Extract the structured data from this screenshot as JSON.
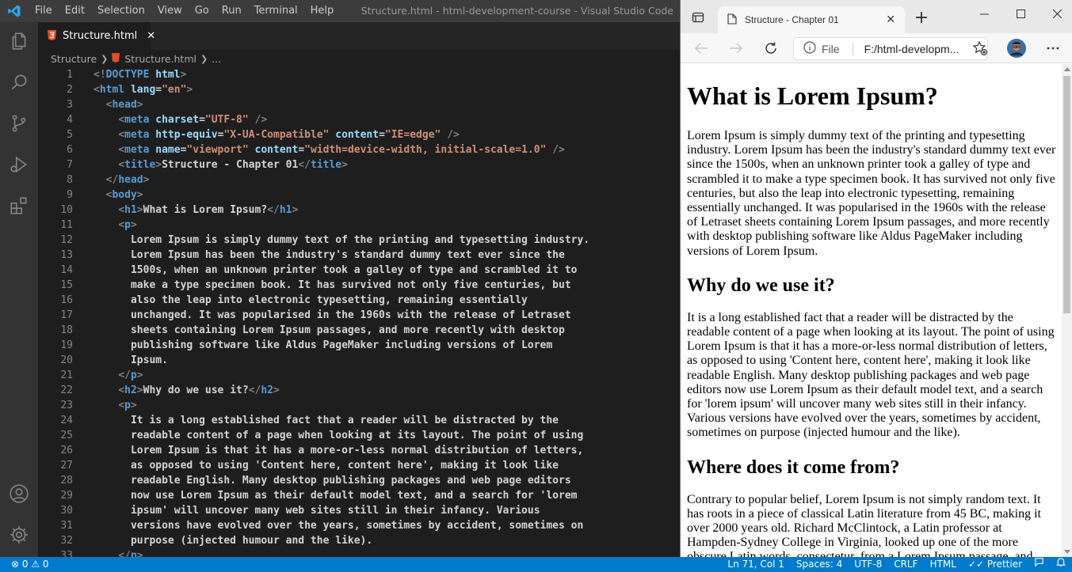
{
  "vscode": {
    "menu": [
      "File",
      "Edit",
      "Selection",
      "View",
      "Go",
      "Run",
      "Terminal",
      "Help"
    ],
    "window_title": "Structure.html - html-development-course - Visual Studio Code",
    "tab": {
      "label": "Structure.html",
      "close": "✕"
    },
    "breadcrumb": {
      "folder": "Structure",
      "file": "Structure.html",
      "more": "..."
    },
    "code_lines": [
      {
        "n": "1",
        "s": [
          [
            "p",
            "<!"
          ],
          [
            "tag",
            "DOCTYPE"
          ],
          [
            "text",
            " "
          ],
          [
            "attr",
            "html"
          ],
          [
            "p",
            ">"
          ]
        ]
      },
      {
        "n": "2",
        "s": [
          [
            "p",
            "<"
          ],
          [
            "tag",
            "html"
          ],
          [
            "text",
            " "
          ],
          [
            "attr",
            "lang"
          ],
          [
            "text",
            "="
          ],
          [
            "str",
            "\"en\""
          ],
          [
            "p",
            ">"
          ]
        ]
      },
      {
        "n": "3",
        "s": [
          [
            "text",
            "  "
          ],
          [
            "p",
            "<"
          ],
          [
            "tag",
            "head"
          ],
          [
            "p",
            ">"
          ]
        ]
      },
      {
        "n": "4",
        "s": [
          [
            "text",
            "    "
          ],
          [
            "p",
            "<"
          ],
          [
            "tag",
            "meta"
          ],
          [
            "text",
            " "
          ],
          [
            "attr",
            "charset"
          ],
          [
            "text",
            "="
          ],
          [
            "str",
            "\"UTF-8\""
          ],
          [
            "text",
            " "
          ],
          [
            "p",
            "/>"
          ]
        ]
      },
      {
        "n": "5",
        "s": [
          [
            "text",
            "    "
          ],
          [
            "p",
            "<"
          ],
          [
            "tag",
            "meta"
          ],
          [
            "text",
            " "
          ],
          [
            "attr",
            "http-equiv"
          ],
          [
            "text",
            "="
          ],
          [
            "str",
            "\"X-UA-Compatible\""
          ],
          [
            "text",
            " "
          ],
          [
            "attr",
            "content"
          ],
          [
            "text",
            "="
          ],
          [
            "str",
            "\"IE=edge\""
          ],
          [
            "text",
            " "
          ],
          [
            "p",
            "/>"
          ]
        ]
      },
      {
        "n": "6",
        "s": [
          [
            "text",
            "    "
          ],
          [
            "p",
            "<"
          ],
          [
            "tag",
            "meta"
          ],
          [
            "text",
            " "
          ],
          [
            "attr",
            "name"
          ],
          [
            "text",
            "="
          ],
          [
            "str",
            "\"viewport\""
          ],
          [
            "text",
            " "
          ],
          [
            "attr",
            "content"
          ],
          [
            "text",
            "="
          ],
          [
            "str",
            "\"width=device-width, initial-scale=1.0\""
          ],
          [
            "text",
            " "
          ],
          [
            "p",
            "/>"
          ]
        ]
      },
      {
        "n": "7",
        "s": [
          [
            "text",
            "    "
          ],
          [
            "p",
            "<"
          ],
          [
            "tag",
            "title"
          ],
          [
            "p",
            ">"
          ],
          [
            "text",
            "Structure - Chapter 01"
          ],
          [
            "p",
            "</"
          ],
          [
            "tag",
            "title"
          ],
          [
            "p",
            ">"
          ]
        ]
      },
      {
        "n": "8",
        "s": [
          [
            "text",
            "  "
          ],
          [
            "p",
            "</"
          ],
          [
            "tag",
            "head"
          ],
          [
            "p",
            ">"
          ]
        ]
      },
      {
        "n": "9",
        "s": [
          [
            "text",
            "  "
          ],
          [
            "p",
            "<"
          ],
          [
            "tag",
            "body"
          ],
          [
            "p",
            ">"
          ]
        ]
      },
      {
        "n": "10",
        "s": [
          [
            "text",
            "    "
          ],
          [
            "p",
            "<"
          ],
          [
            "tag",
            "h1"
          ],
          [
            "p",
            ">"
          ],
          [
            "text",
            "What is Lorem Ipsum?"
          ],
          [
            "p",
            "</"
          ],
          [
            "tag",
            "h1"
          ],
          [
            "p",
            ">"
          ]
        ]
      },
      {
        "n": "11",
        "s": [
          [
            "text",
            "    "
          ],
          [
            "p",
            "<"
          ],
          [
            "tag",
            "p"
          ],
          [
            "p",
            ">"
          ]
        ]
      },
      {
        "n": "12",
        "s": [
          [
            "text",
            "      Lorem Ipsum is simply dummy text of the printing and typesetting industry."
          ]
        ]
      },
      {
        "n": "13",
        "s": [
          [
            "text",
            "      Lorem Ipsum has been the industry's standard dummy text ever since the"
          ]
        ]
      },
      {
        "n": "14",
        "s": [
          [
            "text",
            "      1500s, when an unknown printer took a galley of type and scrambled it to"
          ]
        ]
      },
      {
        "n": "15",
        "s": [
          [
            "text",
            "      make a type specimen book. It has survived not only five centuries, but"
          ]
        ]
      },
      {
        "n": "16",
        "s": [
          [
            "text",
            "      also the leap into electronic typesetting, remaining essentially"
          ]
        ]
      },
      {
        "n": "17",
        "s": [
          [
            "text",
            "      unchanged. It was popularised in the 1960s with the release of Letraset"
          ]
        ]
      },
      {
        "n": "18",
        "s": [
          [
            "text",
            "      sheets containing Lorem Ipsum passages, and more recently with desktop"
          ]
        ]
      },
      {
        "n": "19",
        "s": [
          [
            "text",
            "      publishing software like Aldus PageMaker including versions of Lorem"
          ]
        ]
      },
      {
        "n": "20",
        "s": [
          [
            "text",
            "      Ipsum."
          ]
        ]
      },
      {
        "n": "21",
        "s": [
          [
            "text",
            "    "
          ],
          [
            "p",
            "</"
          ],
          [
            "tag",
            "p"
          ],
          [
            "p",
            ">"
          ]
        ]
      },
      {
        "n": "22",
        "s": [
          [
            "text",
            "    "
          ],
          [
            "p",
            "<"
          ],
          [
            "tag",
            "h2"
          ],
          [
            "p",
            ">"
          ],
          [
            "text",
            "Why do we use it?"
          ],
          [
            "p",
            "</"
          ],
          [
            "tag",
            "h2"
          ],
          [
            "p",
            ">"
          ]
        ]
      },
      {
        "n": "23",
        "s": [
          [
            "text",
            "    "
          ],
          [
            "p",
            "<"
          ],
          [
            "tag",
            "p"
          ],
          [
            "p",
            ">"
          ]
        ]
      },
      {
        "n": "24",
        "s": [
          [
            "text",
            "      It is a long established fact that a reader will be distracted by the"
          ]
        ]
      },
      {
        "n": "25",
        "s": [
          [
            "text",
            "      readable content of a page when looking at its layout. The point of using"
          ]
        ]
      },
      {
        "n": "26",
        "s": [
          [
            "text",
            "      Lorem Ipsum is that it has a more-or-less normal distribution of letters,"
          ]
        ]
      },
      {
        "n": "27",
        "s": [
          [
            "text",
            "      as opposed to using 'Content here, content here', making it look like"
          ]
        ]
      },
      {
        "n": "28",
        "s": [
          [
            "text",
            "      readable English. Many desktop publishing packages and web page editors"
          ]
        ]
      },
      {
        "n": "29",
        "s": [
          [
            "text",
            "      now use Lorem Ipsum as their default model text, and a search for 'lorem"
          ]
        ]
      },
      {
        "n": "30",
        "s": [
          [
            "text",
            "      ipsum' will uncover many web sites still in their infancy. Various"
          ]
        ]
      },
      {
        "n": "31",
        "s": [
          [
            "text",
            "      versions have evolved over the years, sometimes by accident, sometimes on"
          ]
        ]
      },
      {
        "n": "32",
        "s": [
          [
            "text",
            "      purpose (injected humour and the like)."
          ]
        ]
      },
      {
        "n": "33",
        "s": [
          [
            "text",
            "    "
          ],
          [
            "p",
            "</"
          ],
          [
            "tag",
            "p"
          ],
          [
            "p",
            ">"
          ]
        ]
      }
    ],
    "status": {
      "problems": "⊗ 0 ⚠ 0",
      "position": "Ln 71, Col 1",
      "spaces": "Spaces: 4",
      "encoding": "UTF-8",
      "eol": "CRLF",
      "language": "HTML",
      "formatter": "✓✓ Prettier"
    }
  },
  "browser": {
    "tab_title": "Structure - Chapter 01",
    "tab_close": "✕",
    "new_tab": "+",
    "address_scheme": "File",
    "address_url": "F:/html-developm...",
    "page": {
      "h1": "What is Lorem Ipsum?",
      "p1": "Lorem Ipsum is simply dummy text of the printing and typesetting industry. Lorem Ipsum has been the industry's standard dummy text ever since the 1500s, when an unknown printer took a galley of type and scrambled it to make a type specimen book. It has survived not only five centuries, but also the leap into electronic typesetting, remaining essentially unchanged. It was popularised in the 1960s with the release of Letraset sheets containing Lorem Ipsum passages, and more recently with desktop publishing software like Aldus PageMaker including versions of Lorem Ipsum.",
      "h2a": "Why do we use it?",
      "p2": "It is a long established fact that a reader will be distracted by the readable content of a page when looking at its layout. The point of using Lorem Ipsum is that it has a more-or-less normal distribution of letters, as opposed to using 'Content here, content here', making it look like readable English. Many desktop publishing packages and web page editors now use Lorem Ipsum as their default model text, and a search for 'lorem ipsum' will uncover many web sites still in their infancy. Various versions have evolved over the years, sometimes by accident, sometimes on purpose (injected humour and the like).",
      "h2b": "Where does it come from?",
      "p3": "Contrary to popular belief, Lorem Ipsum is not simply random text. It has roots in a piece of classical Latin literature from 45 BC, making it over 2000 years old. Richard McClintock, a Latin professor at Hampden-Sydney College in Virginia, looked up one of the more obscure Latin words, consectetur, from a Lorem Ipsum passage, and"
    }
  },
  "colors": {
    "status_bar": "#007acc",
    "tag": "#569cd6",
    "attr": "#9cdcfe",
    "string": "#ce9178"
  }
}
